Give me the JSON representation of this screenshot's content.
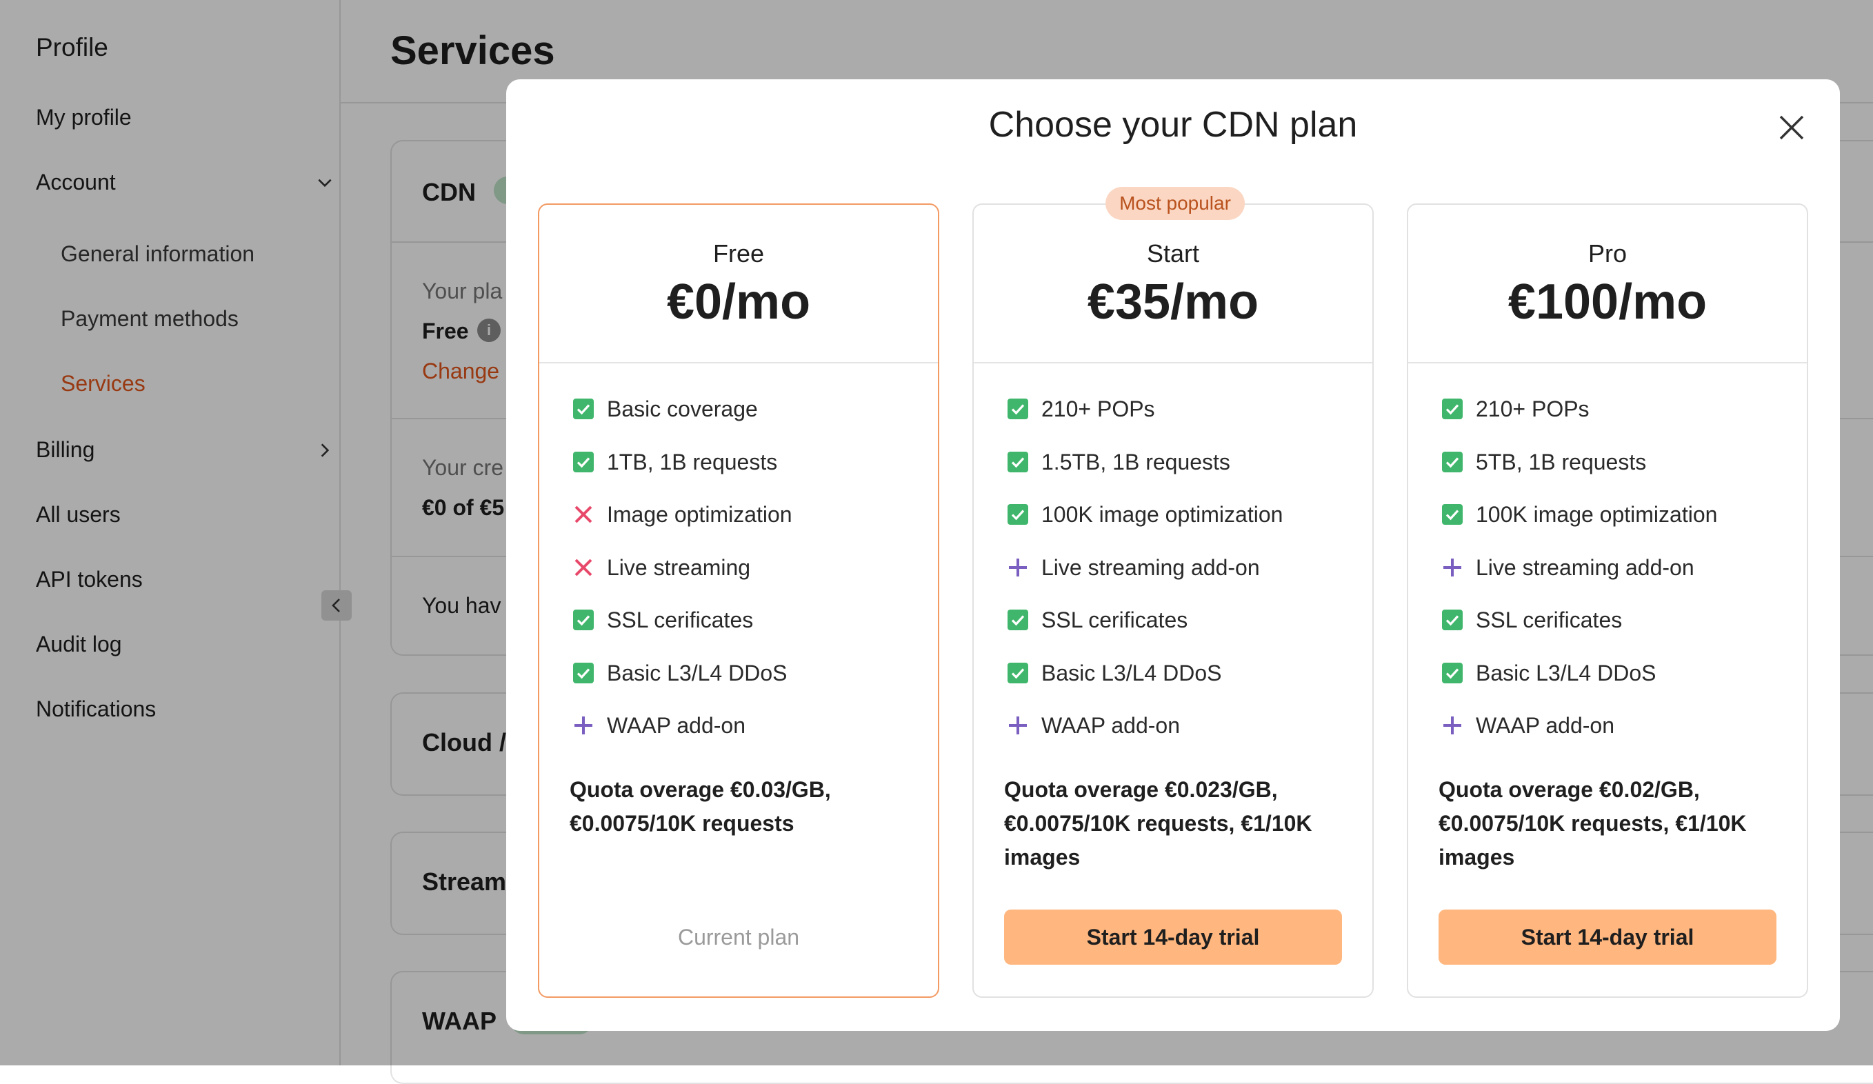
{
  "sidebar": {
    "heading": "Profile",
    "items": {
      "my_profile": "My profile",
      "account": "Account",
      "general_information": "General information",
      "payment_methods": "Payment methods",
      "services": "Services",
      "billing": "Billing",
      "all_users": "All users",
      "api_tokens": "API tokens",
      "audit_log": "Audit log",
      "notifications": "Notifications"
    }
  },
  "main": {
    "title": "Services",
    "cdn_section": {
      "title": "CDN",
      "plan_label": "Your pla",
      "plan_value": "Free",
      "change_link": "Change",
      "credit_label": "Your cre",
      "credit_value": "€0 of €5",
      "notice": "You hav"
    },
    "cloud_section": {
      "title": "Cloud /"
    },
    "streaming_section": {
      "title": "Stream"
    },
    "waap_section": {
      "title": "WAAP"
    }
  },
  "modal": {
    "title": "Choose your CDN plan",
    "popular_badge": "Most popular",
    "plans": [
      {
        "name": "Free",
        "price": "€0/mo",
        "features": [
          {
            "text": "Basic coverage",
            "icon": "check"
          },
          {
            "text": "1TB, 1B requests",
            "icon": "check"
          },
          {
            "text": "Image optimization",
            "icon": "cross"
          },
          {
            "text": "Live streaming",
            "icon": "cross"
          },
          {
            "text": "SSL cerificates",
            "icon": "check"
          },
          {
            "text": "Basic L3/L4 DDoS",
            "icon": "check"
          },
          {
            "text": "WAAP add-on",
            "icon": "plus"
          }
        ],
        "quota": "Quota overage €0.03/GB, €0.0075/10K requests",
        "action": "Current plan"
      },
      {
        "name": "Start",
        "price": "€35/mo",
        "features": [
          {
            "text": "210+ POPs",
            "icon": "check"
          },
          {
            "text": "1.5TB, 1B requests",
            "icon": "check"
          },
          {
            "text": "100K image optimization",
            "icon": "check"
          },
          {
            "text": "Live streaming add-on",
            "icon": "plus"
          },
          {
            "text": "SSL cerificates",
            "icon": "check"
          },
          {
            "text": "Basic L3/L4 DDoS",
            "icon": "check"
          },
          {
            "text": "WAAP add-on",
            "icon": "plus"
          }
        ],
        "quota": "Quota overage €0.023/GB, €0.0075/10K requests, €1/10K images",
        "action": "Start 14-day trial"
      },
      {
        "name": "Pro",
        "price": "€100/mo",
        "features": [
          {
            "text": "210+ POPs",
            "icon": "check"
          },
          {
            "text": "5TB, 1B requests",
            "icon": "check"
          },
          {
            "text": "100K image optimization",
            "icon": "check"
          },
          {
            "text": "Live streaming add-on",
            "icon": "plus"
          },
          {
            "text": "SSL cerificates",
            "icon": "check"
          },
          {
            "text": "Basic L3/L4 DDoS",
            "icon": "check"
          },
          {
            "text": "WAAP add-on",
            "icon": "plus"
          }
        ],
        "quota": "Quota overage €0.02/GB, €0.0075/10K requests, €1/10K images",
        "action": "Start 14-day trial"
      }
    ]
  },
  "colors": {
    "accent": "#e3561b",
    "check_green": "#3fb66b",
    "cross_red": "#e8496a",
    "plus_purple": "#7a5fc0",
    "trial_button": "#ffb77f",
    "current_plan_border": "#f39a63",
    "badge_bg": "#fbd7c3"
  }
}
